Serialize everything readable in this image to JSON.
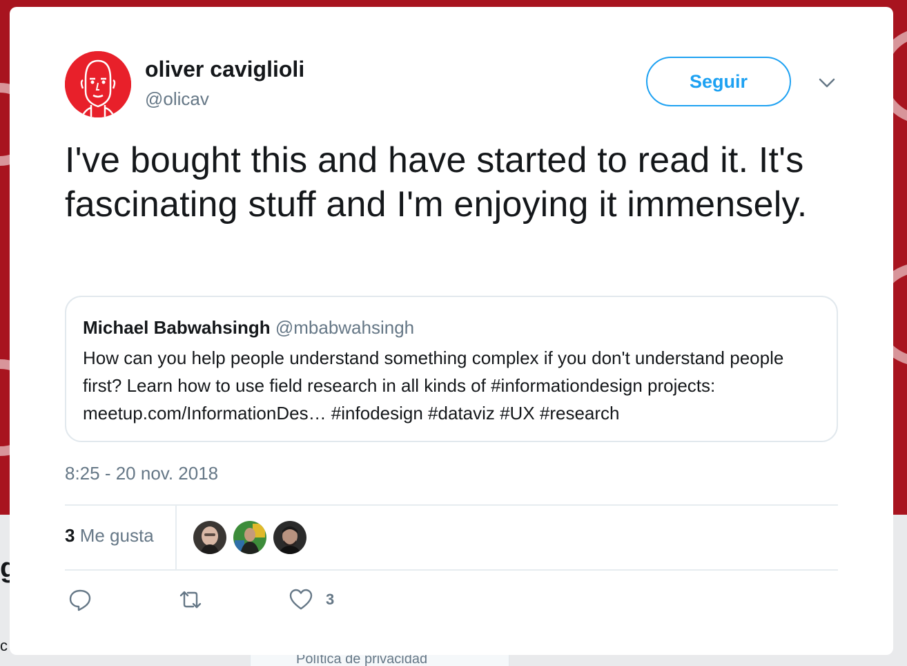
{
  "background": {
    "privacy_link": "Política de privacidad",
    "fragment_g": "g",
    "fragment_c": "c"
  },
  "tweet": {
    "author_name": "oliver caviglioli",
    "author_handle": "@olicav",
    "follow_label": "Seguir",
    "text": "I've bought this and have started to read it. It's fascinating stuff and I'm enjoying it immensely.",
    "quoted": {
      "author_name": "Michael Babwahsingh",
      "author_handle": "@mbabwahsingh",
      "text": "How can you help people understand something complex if you don't understand people first? Learn how to use field research in all kinds of #informationdesign projects: meetup.com/InformationDes… #infodesign #dataviz #UX #research"
    },
    "timestamp": "8:25 - 20 nov. 2018",
    "likes_count": "3",
    "likes_label": "Me gusta",
    "like_action_count": "3"
  },
  "colors": {
    "accent": "#1da1f2",
    "background_red": "#a8141f",
    "avatar_red": "#e8202a",
    "secondary_text": "#657786"
  },
  "icons": {
    "reply": "reply-icon",
    "retweet": "retweet-icon",
    "like": "heart-icon",
    "menu": "chevron-down-icon"
  }
}
